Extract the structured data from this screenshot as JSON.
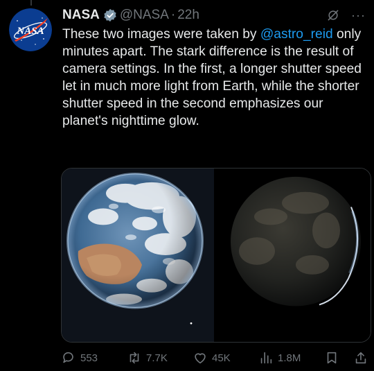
{
  "tweet": {
    "author_name": "NASA",
    "handle": "@NASA",
    "separator": "·",
    "time": "22h",
    "more_label": "···",
    "avatar_text": "NASA",
    "text_before_mention": "These two images were taken by ",
    "mention": "@astro_reid",
    "text_after_mention": " only minutes apart. The stark difference is the result of camera settings. In the first, a longer shutter speed let in much more light from Earth, while the shorter shutter speed in the second emphasizes our planet's nighttime glow."
  },
  "metrics": {
    "replies": "553",
    "reposts": "7.7K",
    "likes": "45K",
    "views": "1.8M"
  },
  "icons": {
    "verified": "verified-badge-icon",
    "grok": "grok-icon",
    "more": "more-icon",
    "reply": "reply-icon",
    "repost": "repost-icon",
    "like": "heart-icon",
    "views": "views-icon",
    "bookmark": "bookmark-icon",
    "share": "share-icon"
  },
  "colors": {
    "background": "#000000",
    "text": "#e7e9ea",
    "secondary": "#71767b",
    "link": "#1d9bf0",
    "nasa_blue": "#0b3d91",
    "nasa_red": "#fc3d21"
  }
}
